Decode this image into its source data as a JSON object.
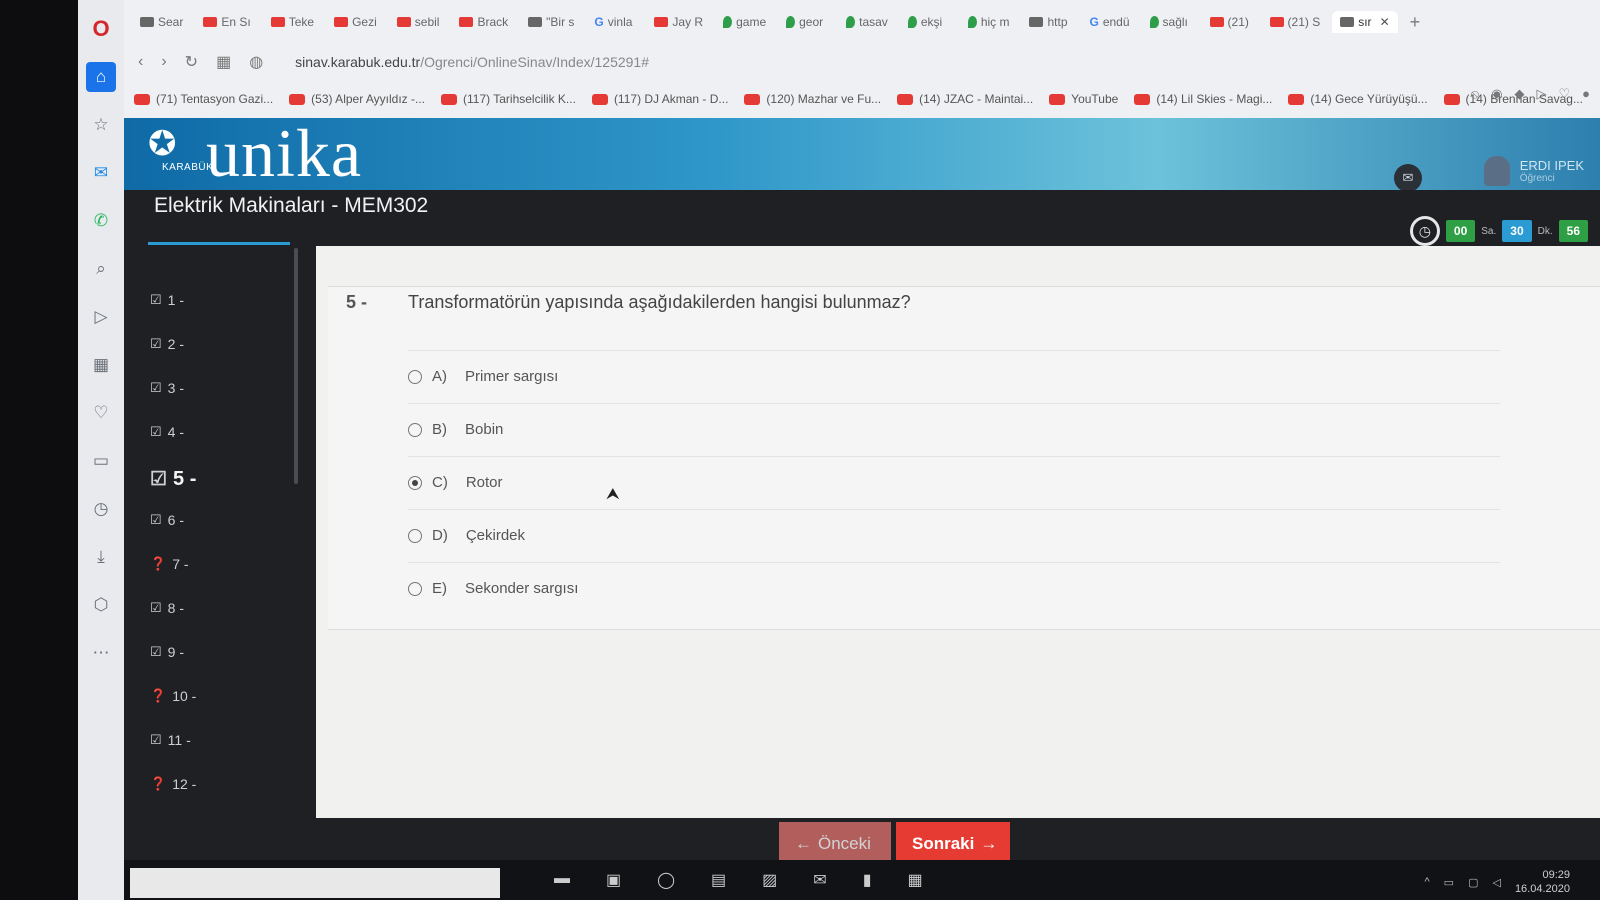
{
  "browser": {
    "tabs": [
      {
        "label": "Sear",
        "icon": "opera-icon"
      },
      {
        "label": "En Sı",
        "icon": "youtube-icon"
      },
      {
        "label": "Teke",
        "icon": "youtube-icon"
      },
      {
        "label": "Gezi",
        "icon": "youtube-icon"
      },
      {
        "label": "sebil",
        "icon": "youtube-icon"
      },
      {
        "label": "Brack",
        "icon": "youtube-icon"
      },
      {
        "label": "\"Bir s",
        "icon": "page-icon"
      },
      {
        "label": "vinla",
        "icon": "google-icon"
      },
      {
        "label": "Jay R",
        "icon": "youtube-icon"
      },
      {
        "label": "game",
        "icon": "drop-icon"
      },
      {
        "label": "geor",
        "icon": "drop-icon"
      },
      {
        "label": "tasav",
        "icon": "drop-icon"
      },
      {
        "label": "ekşi",
        "icon": "drop-icon"
      },
      {
        "label": "hiç m",
        "icon": "drop-icon"
      },
      {
        "label": "http",
        "icon": "page-icon"
      },
      {
        "label": "endü",
        "icon": "google-icon"
      },
      {
        "label": "sağlı",
        "icon": "drop-icon"
      },
      {
        "label": "(21)",
        "icon": "youtube-icon"
      },
      {
        "label": "(21) S",
        "icon": "youtube-icon"
      },
      {
        "label": "sır",
        "icon": "page-icon",
        "active": true
      }
    ],
    "url_host": "sinav.karabuk.edu.tr",
    "url_path": "/Ogrenci/OnlineSinav/Index/125291#",
    "bookmarks": [
      "(71) Tentasyon Gazi...",
      "(53) Alper Ayyıldız -...",
      "(117) Tarihselcilik K...",
      "(117) DJ Akman - D...",
      "(120) Mazhar ve Fu...",
      "(14) JZAC - Maintai...",
      "YouTube",
      "(14) Lil Skies - Magi...",
      "(14) Gece Yürüyüşü...",
      "(14) Brennan Savag..."
    ]
  },
  "header": {
    "logo_text": "unika",
    "logo_tag": "KARABÜK",
    "user_name": "ERDI IPEK",
    "user_role": "Öğrenci",
    "course_title": "Elektrik Makinaları - MEM302",
    "timer": {
      "hours": "00",
      "hours_unit": "Sa.",
      "minutes": "30",
      "minutes_unit": "Dk.",
      "seconds": "56"
    }
  },
  "sidebar": {
    "questions": [
      {
        "label": "1 -",
        "status": "answered"
      },
      {
        "label": "2 -",
        "status": "answered"
      },
      {
        "label": "3 -",
        "status": "answered"
      },
      {
        "label": "4 -",
        "status": "answered"
      },
      {
        "label": "5 -",
        "status": "answered",
        "active": true
      },
      {
        "label": "6 -",
        "status": "answered"
      },
      {
        "label": "7 -",
        "status": "unanswered"
      },
      {
        "label": "8 -",
        "status": "answered"
      },
      {
        "label": "9 -",
        "status": "answered"
      },
      {
        "label": "10 -",
        "status": "unanswered"
      },
      {
        "label": "11 -",
        "status": "answered"
      },
      {
        "label": "12 -",
        "status": "unanswered"
      }
    ]
  },
  "question": {
    "number": "5 -",
    "text": "Transformatörün yapısında aşağıdakilerden hangisi bulunmaz?",
    "options": [
      {
        "letter": "A)",
        "text": "Primer sargısı",
        "selected": false
      },
      {
        "letter": "B)",
        "text": "Bobin",
        "selected": false
      },
      {
        "letter": "C)",
        "text": "Rotor",
        "selected": true
      },
      {
        "letter": "D)",
        "text": "Çekirdek",
        "selected": false
      },
      {
        "letter": "E)",
        "text": "Sekonder sargısı",
        "selected": false
      }
    ]
  },
  "buttons": {
    "prev": "Önceki",
    "next": "Sonraki"
  },
  "taskbar": {
    "time": "09:29",
    "date": "16.04.2020"
  },
  "colors": {
    "accent": "#2a9bd3",
    "next_button": "#e53b32",
    "timer_green": "#2e9f45"
  }
}
